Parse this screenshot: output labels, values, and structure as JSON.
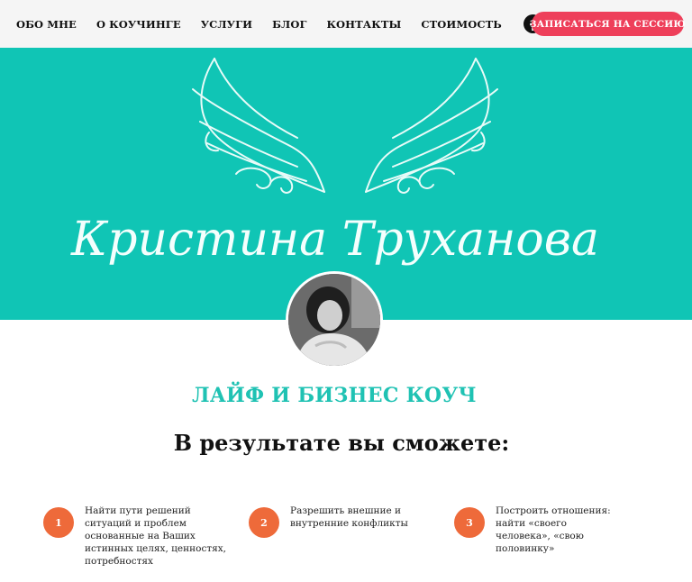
{
  "nav": {
    "links": [
      "ОБО МНЕ",
      "О КОУЧИНГЕ",
      "УСЛУГИ",
      "БЛОГ",
      "КОНТАКТЫ",
      "СТОИМОСТЬ"
    ],
    "socials": [
      "facebook-icon",
      "vk-icon",
      "instagram-icon"
    ],
    "cta_label": "ЗАПИСАТЬСЯ НА СЕССИЮ"
  },
  "hero": {
    "name_script": "Кристина Труханова",
    "background": "#10c5b5"
  },
  "subtitle": "ЛАЙФ И БИЗНЕС КОУЧ",
  "heading": "В результате вы сможете:",
  "results": [
    {
      "number": "1",
      "text": "Найти пути решений ситуаций и проблем основанные на Ваших истинных целях, ценностях, потребностях"
    },
    {
      "number": "2",
      "text": "Разрешить внешние и внутренние конфликты"
    },
    {
      "number": "3",
      "text": "Построить отношения: найти «своего человека», «свою половинку»"
    }
  ],
  "colors": {
    "accent": "#10c5b5",
    "cta": "#ee3f5a",
    "number_badge": "#ee6a3a"
  }
}
